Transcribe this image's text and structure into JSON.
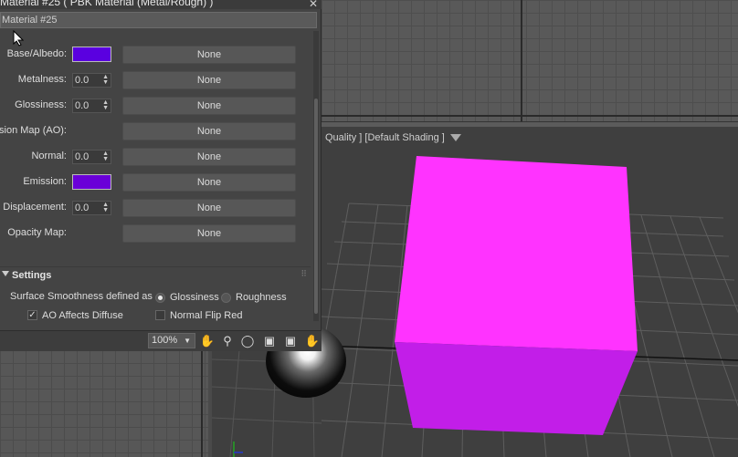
{
  "dialog": {
    "title": "Material #25  ( PBK Material (Metal/Rough) )",
    "material_name": "Material #25",
    "close_glyph": "✕"
  },
  "params": [
    {
      "label": "Base/Albedo:",
      "control": "swatch",
      "color": "#5a00e0",
      "map": "None"
    },
    {
      "label": "Metalness:",
      "control": "spinner",
      "value": "0.0",
      "map": "None"
    },
    {
      "label": "Glossiness:",
      "control": "spinner",
      "value": "0.0",
      "map": "None"
    },
    {
      "label": "Occlusion Map (AO):",
      "control": "none",
      "map": "None"
    },
    {
      "label": "Normal:",
      "control": "spinner",
      "value": "0.0",
      "map": "None"
    },
    {
      "label": "Emission:",
      "control": "swatch",
      "color": "#6a00d8",
      "map": "None"
    },
    {
      "label": "Displacement:",
      "control": "spinner",
      "value": "0.0",
      "map": "None"
    },
    {
      "label": "Opacity Map:",
      "control": "none",
      "map": "None"
    }
  ],
  "settings": {
    "title": "Settings",
    "smoothness_label": "Surface Smoothness defined as",
    "option_glossiness": "Glossiness",
    "option_roughness": "Roughness",
    "selected": "Glossiness",
    "ao_affects_diffuse": "AO Affects Diffuse",
    "ao_checked": true,
    "normal_flip_red": "Normal Flip Red",
    "flip_checked": false
  },
  "toolbar": {
    "zoom": "100%",
    "tools": [
      "pan-hand-icon",
      "zoom-icon",
      "zoom-region-icon",
      "zoom-extents-icon",
      "zoom-extents-selected-icon",
      "pan-view-icon"
    ]
  },
  "viewport": {
    "label": "Quality ] [Default Shading ]",
    "cube_color_front": "#ff33ff",
    "cube_color_side": "#c21ee8"
  }
}
